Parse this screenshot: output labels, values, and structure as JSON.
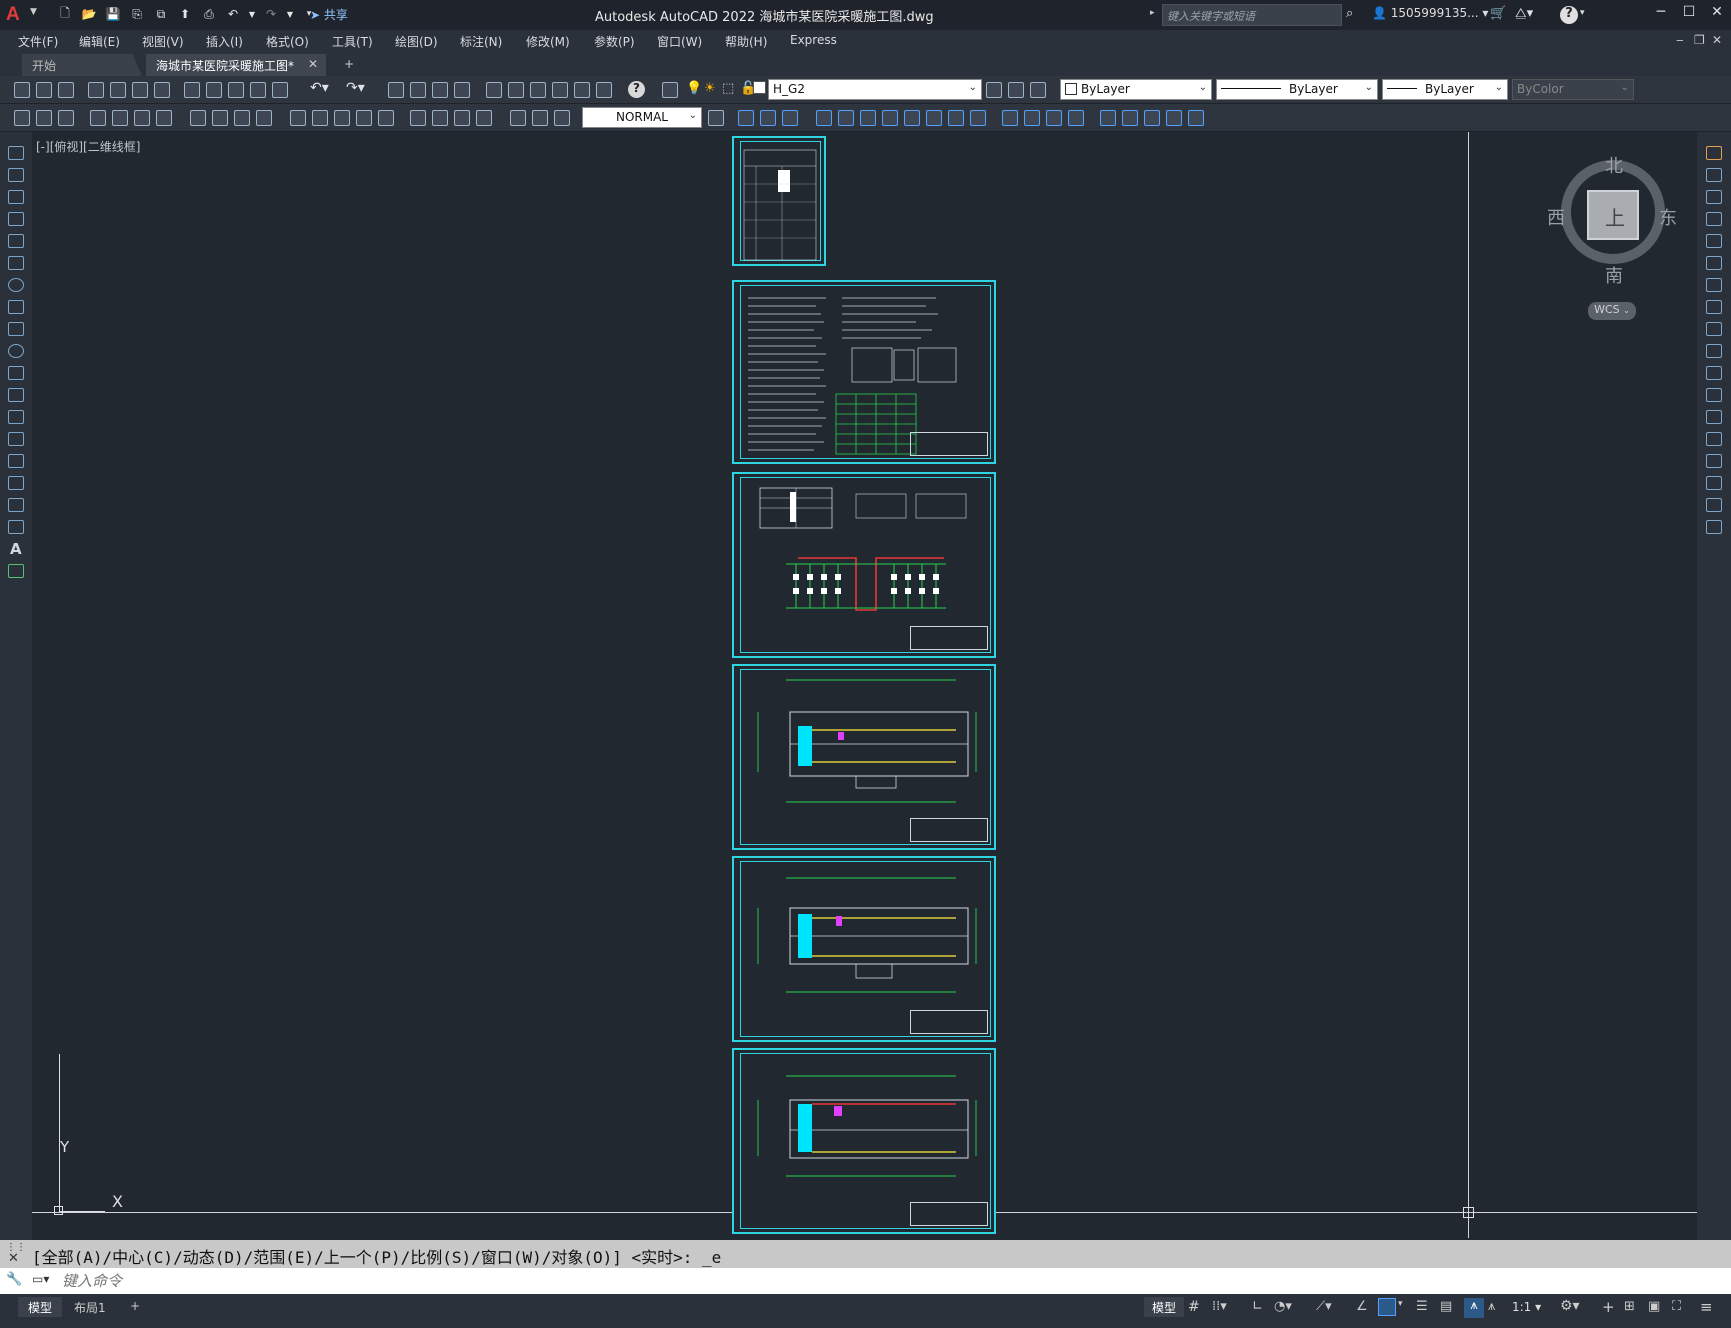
{
  "app": {
    "title": "Autodesk AutoCAD 2022    海城市某医院采暖施工图.dwg",
    "logo": "A",
    "share": "共享",
    "search_placeholder": "键入关键字或短语",
    "user": "1505999135...",
    "help": "?"
  },
  "menu": [
    "文件(F)",
    "编辑(E)",
    "视图(V)",
    "插入(I)",
    "格式(O)",
    "工具(T)",
    "绘图(D)",
    "标注(N)",
    "修改(M)",
    "参数(P)",
    "窗口(W)",
    "帮助(H)",
    "Express"
  ],
  "tabs": {
    "start": "开始",
    "doc": "海城市某医院采暖施工图*",
    "add": "+"
  },
  "toolbar": {
    "layer": "H_G2",
    "color": "ByLayer",
    "linetype": "ByLayer",
    "lineweight": "ByLayer",
    "plotstyle": "ByColor",
    "textstyle": "NORMAL"
  },
  "viewport": {
    "label": "[-][俯视][二维线框]"
  },
  "compass": {
    "north": "北",
    "south": "南",
    "east": "东",
    "west": "西",
    "top": "上",
    "wcs": "WCS"
  },
  "ucs": {
    "x": "X",
    "y": "Y"
  },
  "command": {
    "history": "[全部(A)/中心(C)/动态(D)/范围(E)/上一个(P)/比例(S)/窗口(W)/对象(O)] <实时>: _e",
    "placeholder": "键入命令"
  },
  "status": {
    "model_tab": "模型",
    "layout_tab": "布局1",
    "add": "+",
    "model_btn": "模型",
    "scale": "1:1"
  }
}
